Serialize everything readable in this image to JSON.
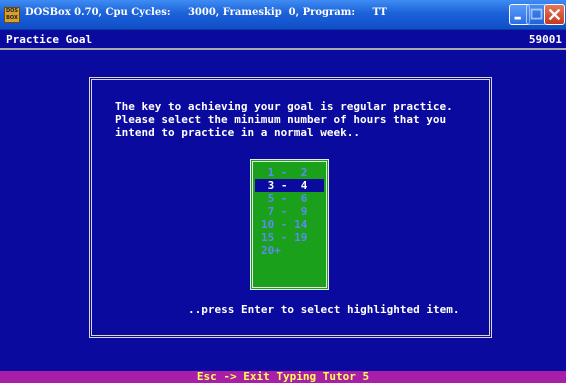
{
  "window": {
    "icon_text": "DOS BOX",
    "title": "DOSBox 0.70, Cpu Cycles:     3000, Frameskip  0, Program:     TT",
    "buttons": [
      "minimize",
      "maximize",
      "close"
    ]
  },
  "header": {
    "title": "Practice Goal",
    "code": "59001"
  },
  "dialog": {
    "intro_lines": [
      "The key to achieving your goal is regular practice.",
      "Please select the minimum number of hours that you",
      "intend to practice in a normal week.."
    ],
    "options": [
      {
        "label": " 1 -  2",
        "selected": false
      },
      {
        "label": " 3 -  4",
        "selected": true
      },
      {
        "label": " 5 -  6",
        "selected": false
      },
      {
        "label": " 7 -  9",
        "selected": false
      },
      {
        "label": "10 - 14",
        "selected": false
      },
      {
        "label": "15 - 19",
        "selected": false
      },
      {
        "label": "20+",
        "selected": false
      }
    ],
    "prompt": "..press Enter to select highlighted item."
  },
  "footer": {
    "text": "Esc -> Exit Typing Tutor 5"
  },
  "colors": {
    "dos_background": "#0a0a9e",
    "list_background": "#1aa01a",
    "list_text": "#5a8cf0",
    "footer_background": "#a81ea8",
    "footer_text": "#ffff55"
  }
}
